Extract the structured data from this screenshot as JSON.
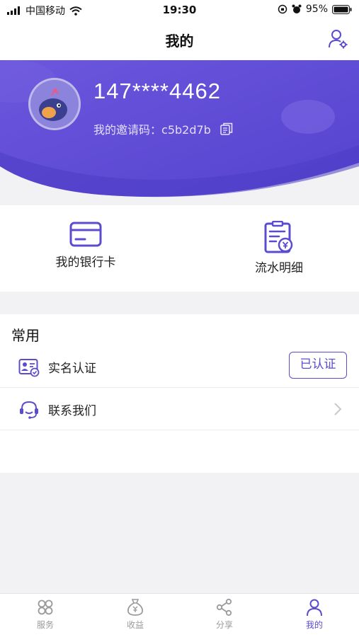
{
  "status_bar": {
    "carrier": "中国移动",
    "time": "19:30",
    "battery": "95%"
  },
  "nav": {
    "title": "我的"
  },
  "profile": {
    "phone": "147****4462",
    "invite_label": "我的邀请码：",
    "invite_code": "c5b2d7b"
  },
  "quick_actions": {
    "bank_card": "我的银行卡",
    "transactions": "流水明细"
  },
  "common": {
    "title": "常用",
    "rows": [
      {
        "label": "实名认证",
        "action": "已认证"
      },
      {
        "label": "联系我们"
      }
    ]
  },
  "tabbar": {
    "items": [
      {
        "label": "服务"
      },
      {
        "label": "收益"
      },
      {
        "label": "分享"
      },
      {
        "label": "我的"
      }
    ]
  },
  "colors": {
    "accent": "#5b4ccf",
    "hero": "#5d4ad3"
  }
}
